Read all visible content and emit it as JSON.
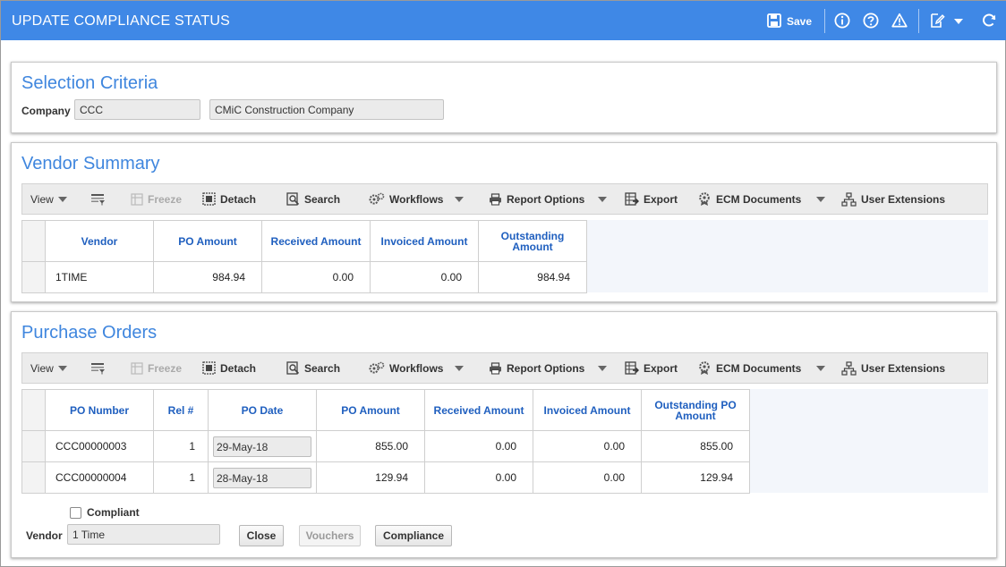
{
  "header": {
    "title": "UPDATE COMPLIANCE STATUS",
    "save_label": "Save",
    "icons": [
      "save-icon",
      "info-icon",
      "help-icon",
      "warning-icon",
      "edit-icon",
      "chevron-down-icon",
      "refresh-icon"
    ],
    "bar_color": "#3f88e6"
  },
  "selection": {
    "title": "Selection Criteria",
    "company_label": "Company",
    "company_code": "CCC",
    "company_name": "CMiC Construction Company"
  },
  "toolbar": {
    "view": "View",
    "freeze": "Freeze",
    "detach": "Detach",
    "search": "Search",
    "workflows": "Workflows",
    "report_options": "Report Options",
    "export": "Export",
    "ecm_documents": "ECM Documents",
    "user_extensions": "User Extensions"
  },
  "vendor_summary": {
    "title": "Vendor Summary",
    "columns": [
      "Vendor",
      "PO Amount",
      "Received Amount",
      "Invoiced Amount",
      "Outstanding Amount"
    ],
    "rows": [
      {
        "vendor": "1TIME",
        "po_amount": "984.94",
        "received": "0.00",
        "invoiced": "0.00",
        "outstanding": "984.94"
      }
    ]
  },
  "purchase_orders": {
    "title": "Purchase Orders",
    "columns": [
      "PO Number",
      "Rel #",
      "PO Date",
      "PO Amount",
      "Received Amount",
      "Invoiced Amount",
      "Outstanding PO Amount"
    ],
    "rows": [
      {
        "po_number": "CCC00000003",
        "rel": "1",
        "po_date": "29-May-18",
        "po_amount": "855.00",
        "received": "0.00",
        "invoiced": "0.00",
        "outstanding": "855.00"
      },
      {
        "po_number": "CCC00000004",
        "rel": "1",
        "po_date": "28-May-18",
        "po_amount": "129.94",
        "received": "0.00",
        "invoiced": "0.00",
        "outstanding": "129.94"
      }
    ],
    "compliant_label": "Compliant",
    "vendor_label": "Vendor",
    "vendor_value": "1 Time",
    "buttons": {
      "close": "Close",
      "vouchers": "Vouchers",
      "compliance": "Compliance"
    }
  }
}
